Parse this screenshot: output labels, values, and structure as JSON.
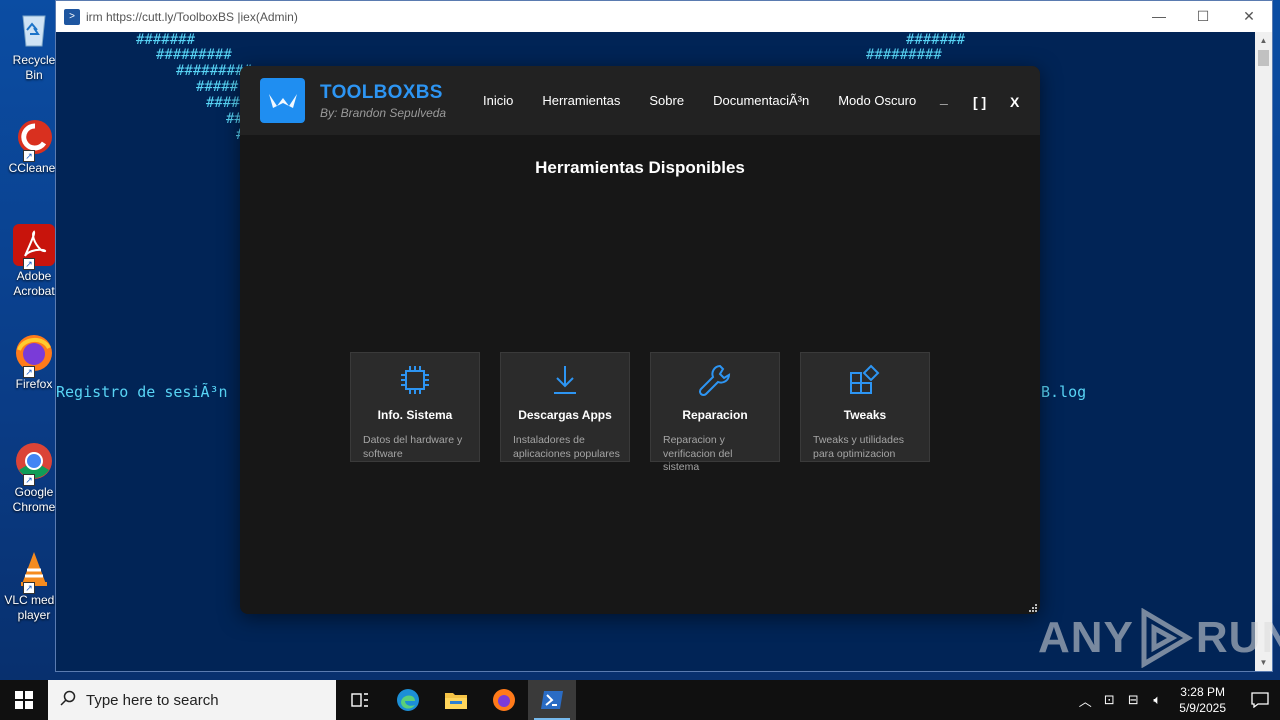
{
  "desktop": {
    "icons": [
      {
        "label": "Recycle Bin",
        "icon": "recycle-bin-icon"
      },
      {
        "label": "CCleaner",
        "icon": "ccleaner-icon"
      },
      {
        "label": "Adobe Acrobat",
        "icon": "adobe-acrobat-icon"
      },
      {
        "label": "Firefox",
        "icon": "firefox-icon"
      },
      {
        "label": "Google Chrome",
        "icon": "chrome-icon"
      },
      {
        "label": "VLC media player",
        "icon": "vlc-icon"
      }
    ]
  },
  "powershell": {
    "title": "irm https://cutt.ly/ToolboxBS |iex(Admin)",
    "controls": {
      "minimize": "—",
      "maximize": "☐",
      "close": "✕"
    },
    "lines": [
      "#######",
      "#########",
      "#########",
      "#####",
      "#####",
      "###",
      "#",
      "#######",
      "#########",
      "Registro de sesiÃ³n",
      "B.log"
    ]
  },
  "app": {
    "brand_title": "TOOLBOXBS",
    "brand_subtitle": "By: Brandon Sepulveda",
    "nav": [
      "Inicio",
      "Herramientas",
      "Sobre",
      "DocumentaciÃ³n",
      "Modo Oscuro"
    ],
    "window_controls": {
      "minimize": "_",
      "maximize": "[ ]",
      "close": "X"
    },
    "main_title": "Herramientas Disponibles",
    "cards": [
      {
        "title": "Info. Sistema",
        "desc": "Datos del hardware y software",
        "icon": "chip-icon"
      },
      {
        "title": "Descargas Apps",
        "desc": "Instaladores de aplicaciones populares",
        "icon": "download-icon"
      },
      {
        "title": "Reparacion",
        "desc": "Reparacion y verificacion del sistema",
        "icon": "wrench-icon"
      },
      {
        "title": "Tweaks",
        "desc": "Tweaks y utilidades para optimizacion",
        "icon": "tweaks-icon"
      }
    ],
    "accent": "#1f8ef1"
  },
  "watermark": {
    "left": "ANY",
    "right": "RUN"
  },
  "taskbar": {
    "search_placeholder": "Type here to search",
    "time": "3:28 PM",
    "date": "5/9/2025"
  }
}
